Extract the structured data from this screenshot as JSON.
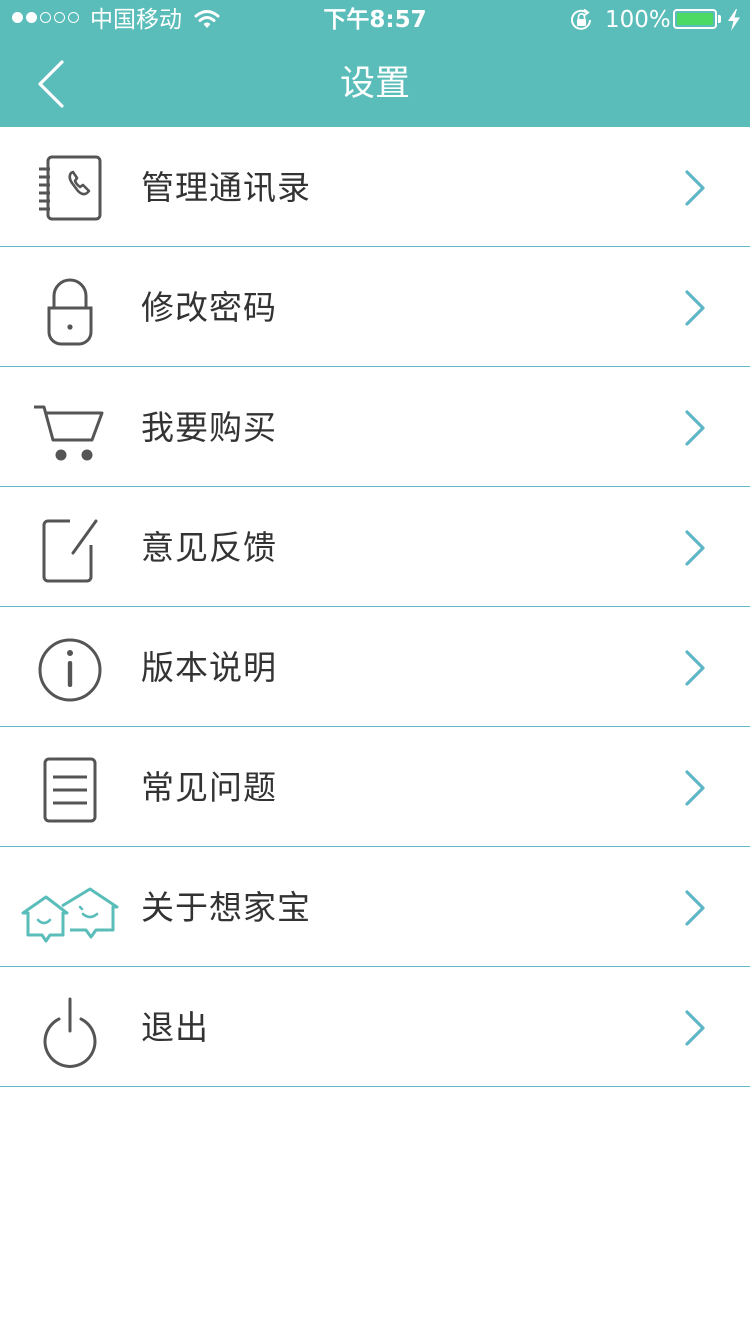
{
  "status_bar": {
    "carrier": "中国移动",
    "time": "下午8:57",
    "battery_percent": "100%",
    "battery_color": "#4cd964",
    "signal_strength": 2,
    "signal_total": 5
  },
  "header": {
    "title": "设置",
    "background_color": "#5abdba",
    "back_icon": "chevron-left-icon"
  },
  "menu": {
    "items": [
      {
        "label": "管理通讯录",
        "icon": "address-book-icon"
      },
      {
        "label": "修改密码",
        "icon": "lock-icon"
      },
      {
        "label": "我要购买",
        "icon": "shopping-cart-icon"
      },
      {
        "label": "意见反馈",
        "icon": "edit-icon"
      },
      {
        "label": "版本说明",
        "icon": "info-icon"
      },
      {
        "label": "常见问题",
        "icon": "document-icon"
      },
      {
        "label": "关于想家宝",
        "icon": "app-logo-icon"
      },
      {
        "label": "退出",
        "icon": "power-icon"
      }
    ],
    "arrow_icon": "chevron-right-icon",
    "accent_color": "#5fb6c4"
  }
}
